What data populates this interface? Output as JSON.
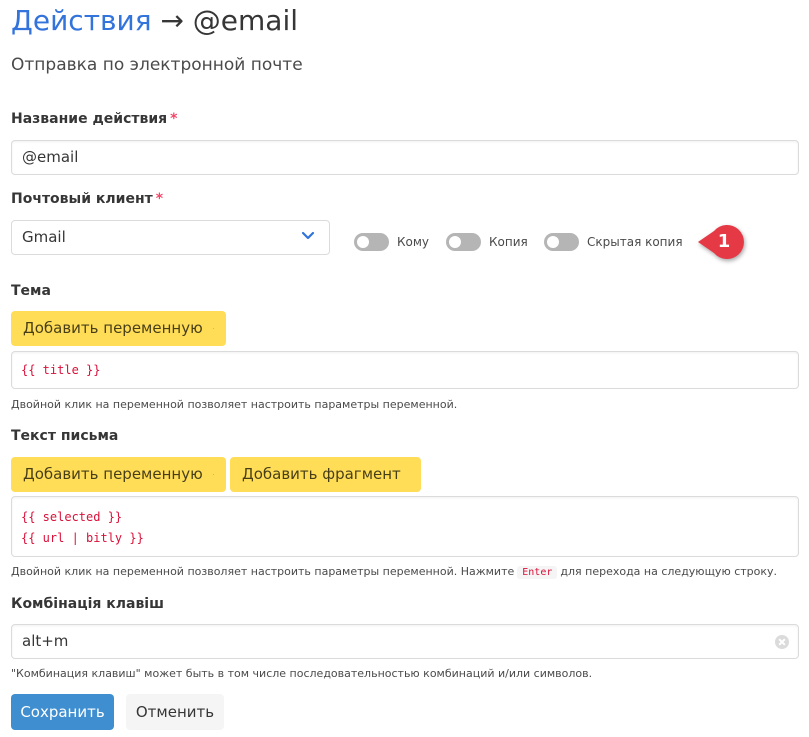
{
  "header": {
    "title_link": "Действия",
    "title_rest": " → @email",
    "subtitle": "Отправка по электронной почте"
  },
  "action_name": {
    "label": "Название действия",
    "required_mark": "*",
    "value": "@email"
  },
  "mail_client": {
    "label": "Почтовый клиент",
    "required_mark": "*",
    "selected": "Gmail"
  },
  "toggles": [
    {
      "label": "Кому",
      "on": false
    },
    {
      "label": "Копия",
      "on": false
    },
    {
      "label": "Скрытая копия",
      "on": false
    }
  ],
  "callout": {
    "number": "1",
    "color": "#e63946"
  },
  "subject": {
    "label": "Тема",
    "add_variable_label": "Добавить переменную",
    "lines": [
      "{{ title }}"
    ],
    "help": "Двойной клик на переменной позволяет настроить параметры переменной."
  },
  "body": {
    "label": "Текст письма",
    "add_variable_label": "Добавить переменную",
    "add_fragment_label": "Добавить фрагмент",
    "lines": [
      "{{ selected }}",
      "{{ url | bitly }}"
    ],
    "help_before": "Двойной клик на переменной позволяет настроить параметры переменной. Нажмите",
    "help_key": "Enter",
    "help_after": "для перехода на следующую строку."
  },
  "shortcut": {
    "label": "Комбінація клавіш",
    "value": "alt+m",
    "help": "\"Комбинация клавиш\" может быть в том числе последовательностью комбинаций и/или символов."
  },
  "buttons": {
    "save": "Сохранить",
    "cancel": "Отменить"
  },
  "colors": {
    "link": "#3273dc",
    "primary": "#3e8ed0",
    "warning": "#ffdd57",
    "danger": "#f14668",
    "code": "#da1039"
  },
  "icons": {
    "select_arrow": "chevron-down-icon",
    "dropdown_caret": "caret-down-icon",
    "clear": "clear-icon"
  }
}
